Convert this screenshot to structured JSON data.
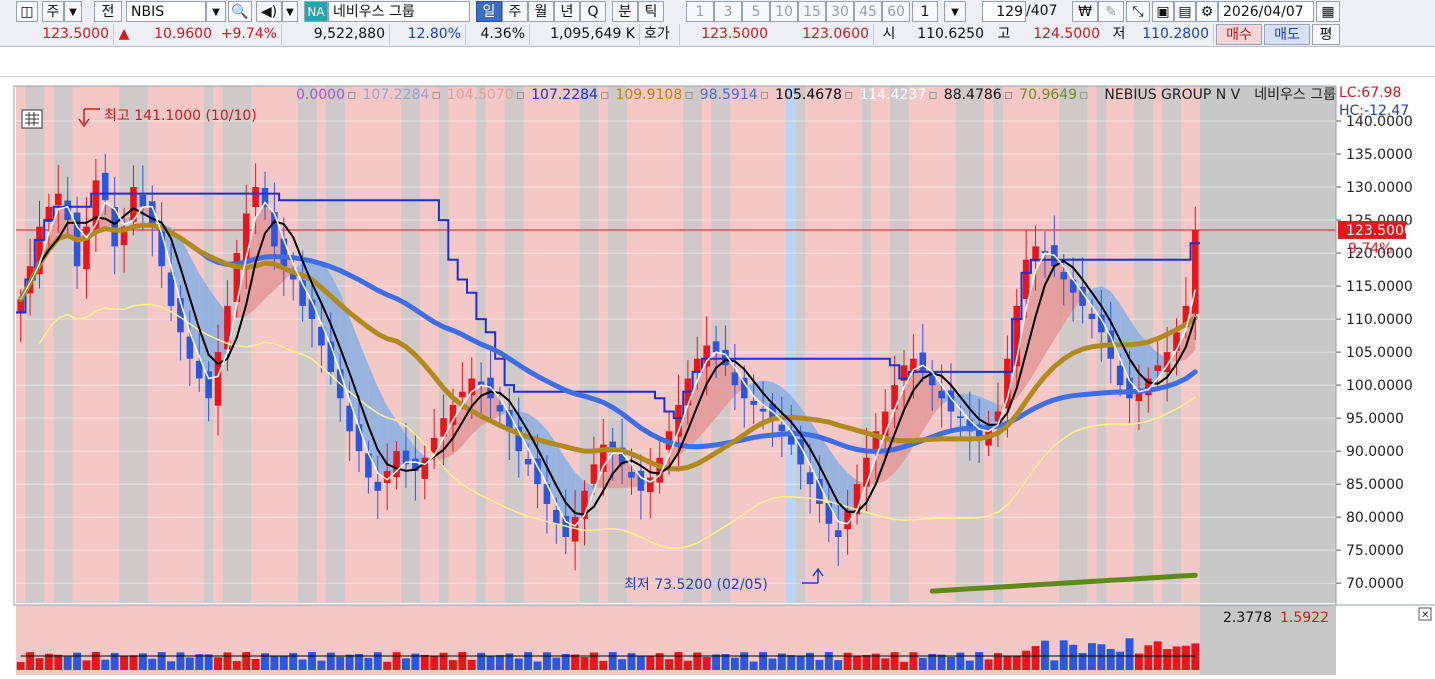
{
  "toolbar": {
    "market_type": "주",
    "jeon_label": "전",
    "symbol_input": "NBIS",
    "market_badge": "NA",
    "company_name": "네비우스 그룹",
    "periods": [
      {
        "label": "일",
        "active": true
      },
      {
        "label": "주",
        "active": false
      },
      {
        "label": "월",
        "active": false
      },
      {
        "label": "년",
        "active": false
      },
      {
        "label": "Q",
        "active": false
      },
      {
        "label": "분",
        "active": false
      },
      {
        "label": "틱",
        "active": false
      }
    ],
    "intervals": [
      "1",
      "3",
      "5",
      "10",
      "15",
      "30",
      "45",
      "60"
    ],
    "interval_count": "1",
    "page_current": "129",
    "page_total": "/407",
    "date_input": "2026/04/07"
  },
  "quote": {
    "price": "123.5000",
    "change_arrow": "▲",
    "change": "10.9600",
    "change_pct": "+9.74%",
    "volume": "9,522,880",
    "volume_ratio": "12.80%",
    "turnover_pct": "4.36%",
    "amount": "1,095,649 K",
    "hoga_label": "호가",
    "hoga_ask": "123.5000",
    "hoga_bid": "123.0600",
    "open_label": "시",
    "open": "110.6250",
    "high_label": "고",
    "high": "124.5000",
    "low_label": "저",
    "low": "110.2800",
    "buy_label": "매수",
    "sell_label": "매도",
    "eval_label": "평"
  },
  "legend": {
    "values": [
      {
        "text": "0.0000",
        "color": "#9b59d6"
      },
      {
        "text": "107.2284",
        "color": "#8fa8d8"
      },
      {
        "text": "104.5070",
        "color": "#e2a0a0"
      },
      {
        "text": "107.2284",
        "color": "#1b2fd8"
      },
      {
        "text": "109.9108",
        "color": "#b8860b"
      },
      {
        "text": "98.5914",
        "color": "#3d6fe8"
      },
      {
        "text": "105.4678",
        "color": "#000000"
      },
      {
        "text": "114.4237",
        "color": "#ffffff"
      },
      {
        "text": "88.4786",
        "color": "#111111"
      },
      {
        "text": "70.9649",
        "color": "#6b8e23"
      }
    ],
    "ticker_name": "NEBIUS GROUP N V",
    "kor_name": "네비우스 그룹",
    "lc_label": "LC:67.98",
    "hc_label": "HC:-12.47"
  },
  "annotations": {
    "high_marker": "최고 141.1000 (10/10)",
    "low_marker": "최저 73.5200 (02/05)",
    "current_price_tag": "123.5000",
    "current_pct_tag": "9.74%"
  },
  "volume_panel": {
    "value1": "2.3778",
    "value2": "1.5922"
  },
  "colors": {
    "up": "#e8161c",
    "down": "#2a56e0",
    "band_up": "#e39a9a",
    "band_down": "#8eb0e0",
    "ma_gold": "#b08a1e",
    "ma_blue": "#3e6de8",
    "ma_green": "#5e8a1a",
    "step_blue": "#1a2fd4",
    "envelope_yellow": "#fff08a"
  },
  "chart_data": {
    "type": "candlestick",
    "ylim": [
      67,
      145
    ],
    "y_ticks": [
      "140.0000",
      "135.0000",
      "130.0000",
      "125.0000",
      "120.0000",
      "115.0000",
      "110.0000",
      "105.0000",
      "100.0000",
      "95.0000",
      "90.0000",
      "85.0000",
      "80.0000",
      "75.0000",
      "70.0000"
    ],
    "y_tick_values": [
      140,
      135,
      130,
      125,
      120,
      115,
      110,
      105,
      100,
      95,
      90,
      85,
      80,
      75,
      70
    ],
    "current_price": 123.5,
    "candle_closes": [
      113,
      118,
      124,
      127,
      129,
      125,
      118,
      124,
      131,
      128,
      121,
      124,
      130,
      127,
      124,
      118,
      112,
      108,
      104,
      101,
      98,
      105,
      112,
      120,
      126,
      130,
      127,
      121,
      118,
      116,
      112,
      110,
      106,
      102,
      98,
      93,
      90,
      86,
      84,
      87,
      90,
      88,
      87,
      89,
      92,
      95,
      97,
      99,
      101,
      100,
      98,
      96,
      93,
      90,
      88,
      85,
      82,
      79,
      77,
      80,
      84,
      88,
      91,
      90,
      88,
      86,
      84,
      86,
      89,
      93,
      97,
      101,
      104,
      106,
      105,
      103,
      100,
      98,
      97,
      96,
      95,
      93,
      91,
      88,
      85,
      82,
      79,
      77,
      81,
      85,
      89,
      93,
      96,
      100,
      103,
      104,
      102,
      100,
      98,
      96,
      95,
      93,
      92,
      94,
      96,
      104,
      112,
      119,
      121,
      120,
      118,
      116,
      114,
      112,
      110,
      108,
      104,
      100,
      98,
      99,
      101,
      103,
      105,
      108,
      112,
      123.5
    ]
  }
}
